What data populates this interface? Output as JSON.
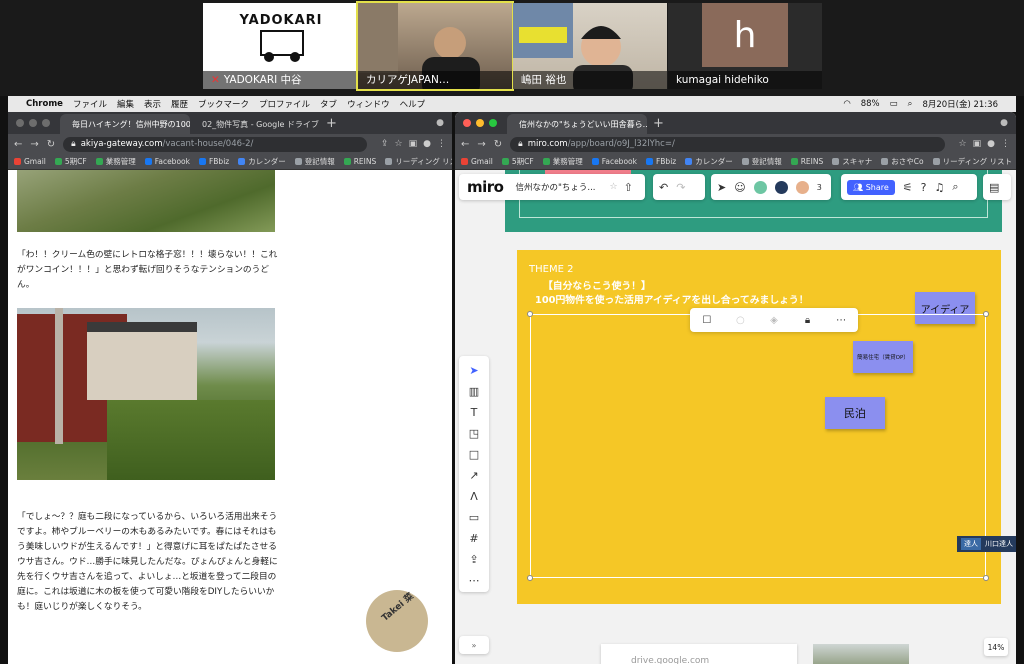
{
  "participants": [
    {
      "name": "YADOKARI 中谷",
      "logo_text": "YADOKARI",
      "muted": true
    },
    {
      "name": "カリアゲJAPAN…",
      "active": true
    },
    {
      "name": "嶋田 裕也"
    },
    {
      "name": "kumagai hidehiko",
      "initial": "h"
    }
  ],
  "menubar": {
    "items": [
      "Chrome",
      "ファイル",
      "編集",
      "表示",
      "履歴",
      "ブックマーク",
      "プロファイル",
      "タブ",
      "ウィンドウ",
      "ヘルプ"
    ],
    "battery": "88%",
    "datetime": "8月20日(金) 21:36"
  },
  "left_window": {
    "tabs": [
      {
        "title": "毎日ハイキング！信州中野の100...",
        "active": true
      },
      {
        "title": "02_物件写真 - Google ドライブ",
        "active": false
      }
    ],
    "url_host": "akiya-gateway.com",
    "url_path": "/vacant-house/046-2/",
    "bookmarks": [
      "Gmail",
      "5期CF",
      "業務管理",
      "Facebook",
      "FBbiz",
      "カレンダー",
      "登記情報",
      "REINS",
      "リーディング リスト"
    ],
    "paragraph1": "「わ！！クリーム色の壁にレトロな格子窓！！！壊らない！！これがワンコイン！！！」と思わず転げ回りそうなテンションのうどん。",
    "paragraph2": "「でしょ～？？庭も二段になっているから、いろいろ活用出来そうですよ。柿やブルーベリーの木もあるみたいです。春にはそれはもう美味しいウドが生えるんです！」と得意げに耳をぱたぱたさせるウサ吉さん。ウド…勝手に味見したんだな。ぴょんぴょんと身軽に先を行くウサ吉さんを追って、よいしょ…と坂道を登って二段目の庭に。これは坂道に木の板を使って可愛い階段をDIYしたらいいかも！庭いじりが楽しくなりそう。",
    "stamp_text": "Takei 菜"
  },
  "right_window": {
    "tab_title": "信州なかの\"ちょうどいい田舎暮ら...",
    "url_host": "miro.com",
    "url_path": "/app/board/o9J_l32lYhc=/",
    "bookmarks": [
      "Gmail",
      "5期CF",
      "業務管理",
      "Facebook",
      "FBbiz",
      "カレンダー",
      "登記情報",
      "REINS",
      "スキャナ",
      "おさやCo",
      "リーディング リスト"
    ],
    "miro": {
      "logo": "miro",
      "board_name": "信州なかの\"ちょう...",
      "participant_count": "3",
      "share_label": "Share",
      "theme_label": "THEME 2",
      "theme_line1": "【自分ならこう使う！】",
      "theme_line2": "100円物件を使った活用アイディアを出し合ってみましょう！",
      "stickies": [
        {
          "label": "アイディア"
        },
        {
          "label": "簡易住宅（賃貸OP）"
        },
        {
          "label": "民泊"
        }
      ],
      "cursor_user_tag": "達人",
      "cursor_user_name": "川口達人",
      "zoom": "14%",
      "bottom_card": "drive.google.com",
      "collapse_label": "»"
    }
  },
  "colors": {
    "miro_yellow": "#f5c726",
    "miro_teal": "#2e9c80",
    "sticky_purple": "#8b8fef",
    "miro_blue": "#4262ff"
  }
}
